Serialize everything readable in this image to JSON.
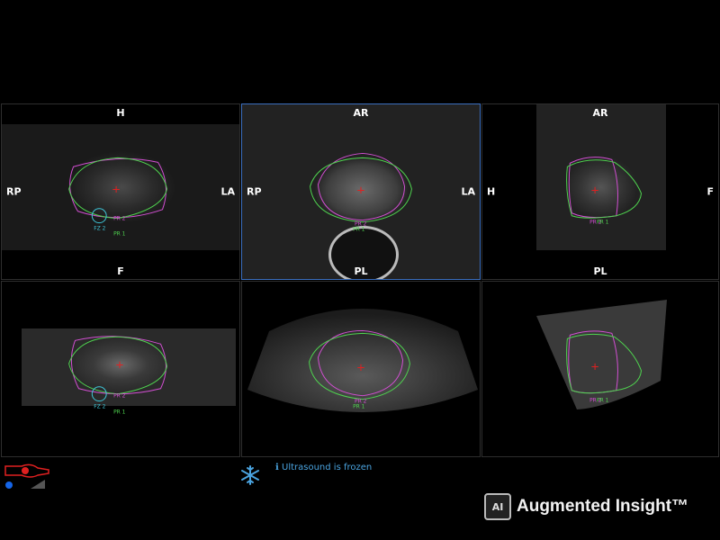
{
  "viewports": {
    "top_left": {
      "top": "H",
      "bottom": "F",
      "left": "RP",
      "right": "LA"
    },
    "top_mid": {
      "top": "AR",
      "bottom": "PL",
      "left": "RP",
      "right": "LA"
    },
    "top_right": {
      "top": "AR",
      "bottom": "PL",
      "left": "H",
      "right": "F"
    },
    "bottom_left": {
      "top": "",
      "bottom": "",
      "left": "",
      "right": ""
    },
    "bottom_mid": {
      "top": "",
      "bottom": "",
      "left": "",
      "right": ""
    },
    "bottom_right": {
      "top": "",
      "bottom": "",
      "left": "",
      "right": ""
    }
  },
  "roi_labels": {
    "pr1": "PR 1",
    "pr2": "PR 2",
    "fz2": "FZ 2"
  },
  "status": {
    "frozen_text": "Ultrasound is frozen",
    "info_icon": "info-icon",
    "freeze_icon": "snowflake-icon"
  },
  "brand": {
    "logo_mark": "AI",
    "name": "Augmented Insight™"
  },
  "colors": {
    "prostate_pink": "#d34fd3",
    "prostate_green": "#4fd34f",
    "fz_cyan": "#3ec6d8",
    "active_border": "#3b6fbf",
    "status_blue": "#4aa3df",
    "probe_red": "#e02020"
  }
}
